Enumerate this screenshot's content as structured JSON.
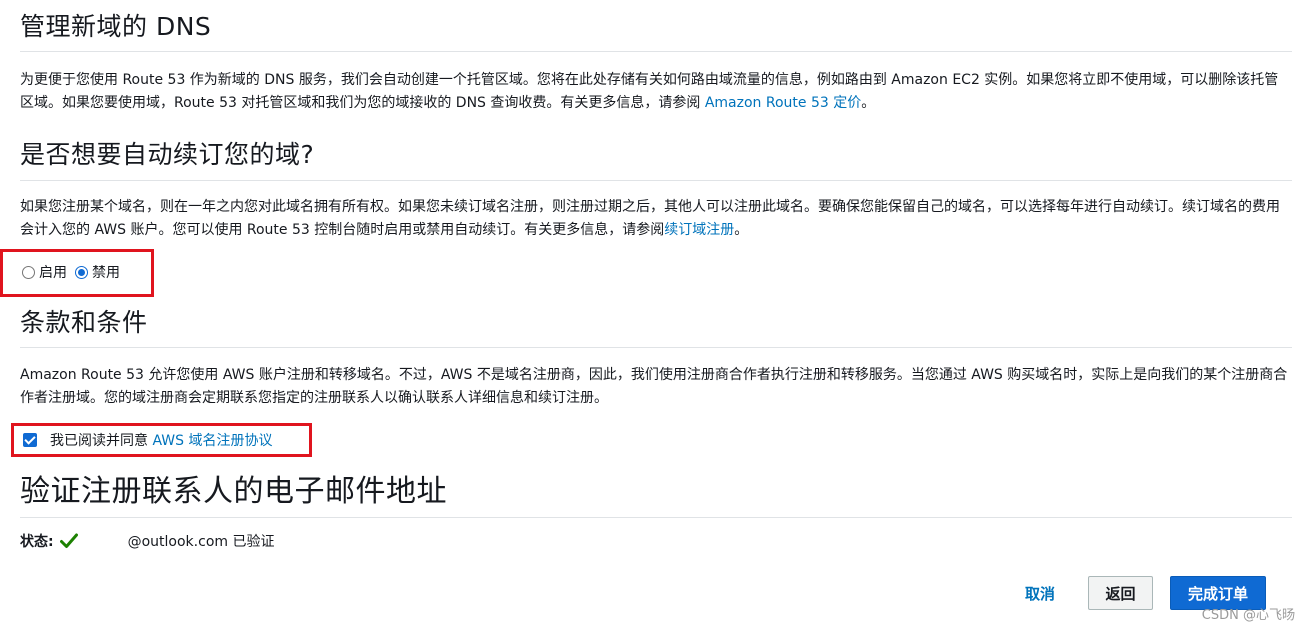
{
  "dns": {
    "title": "管理新域的 DNS",
    "desc": "为更便于您使用 Route 53 作为新域的 DNS 服务，我们会自动创建一个托管区域。您将在此处存储有关如何路由域流量的信息，例如路由到 Amazon EC2 实例。如果您将立即不使用域，可以删除该托管区域。如果您要使用域，Route 53 对托管区域和我们为您的域接收的 DNS 查询收费。有关更多信息，请参阅 ",
    "link": "Amazon Route 53 定价",
    "end": "。"
  },
  "renew": {
    "title": "是否想要自动续订您的域?",
    "desc": "如果您注册某个域名，则在一年之内您对此域名拥有所有权。如果您未续订域名注册，则注册过期之后，其他人可以注册此域名。要确保您能保留自己的域名，可以选择每年进行自动续订。续订域名的费用会计入您的 AWS 账户。您可以使用 Route 53 控制台随时启用或禁用自动续订。有关更多信息，请参阅",
    "link": "续订域注册",
    "end": "。",
    "options": [
      "启用",
      "禁用"
    ],
    "selected": "禁用"
  },
  "terms": {
    "title": "条款和条件",
    "desc": "Amazon Route 53 允许您使用 AWS 账户注册和转移域名。不过，AWS 不是域名注册商，因此，我们使用注册商合作者执行注册和转移服务。当您通过 AWS 购买域名时，实际上是向我们的某个注册商合作者注册域。您的域注册商会定期联系您指定的注册联系人以确认联系人详细信息和续订注册。",
    "agree_text": "我已阅读并同意 ",
    "agree_link": "AWS 域名注册协议",
    "agreed": true
  },
  "verify": {
    "title": "验证注册联系人的电子邮件地址",
    "status_label": "状态:",
    "status_text": "@outlook.com 已验证"
  },
  "actions": {
    "cancel": "取消",
    "back": "返回",
    "complete": "完成订单"
  },
  "watermark": "CSDN @心飞旸",
  "colors": {
    "link": "#0073bb",
    "primary": "#0f6ad3",
    "highlight": "#e0141e",
    "check": "#1d8102"
  },
  "icons": {
    "status": "checkmark-icon"
  }
}
